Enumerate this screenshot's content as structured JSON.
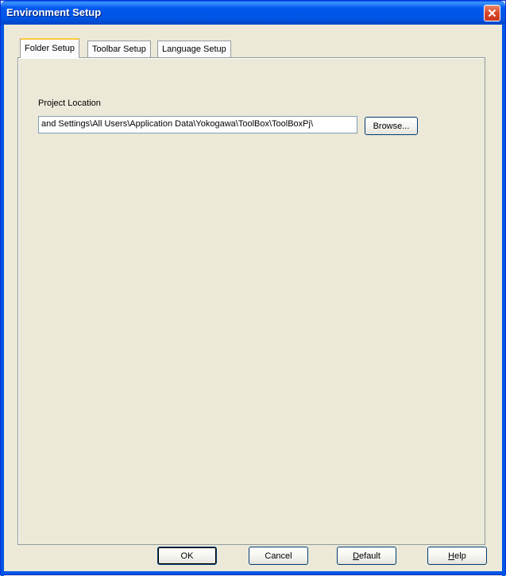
{
  "window": {
    "title": "Environment Setup"
  },
  "tabs": [
    {
      "label": "Folder Setup",
      "active": true
    },
    {
      "label": "Toolbar Setup",
      "active": false
    },
    {
      "label": "Language Setup",
      "active": false
    }
  ],
  "folder_setup": {
    "project_location_label": "Project Location",
    "project_location_value": " and Settings\\All Users\\Application Data\\Yokogawa\\ToolBox\\ToolBoxPj\\",
    "browse_label": "Browse..."
  },
  "footer": {
    "ok_label": "OK",
    "cancel_label": "Cancel",
    "default_label": "Default",
    "default_mnemonic": "D",
    "default_rest": "efault",
    "help_label": "Help",
    "help_mnemonic": "H",
    "help_rest": "elp"
  },
  "colors": {
    "titlebar": "#0055E5",
    "dialog_bg": "#ECE9D8",
    "close_button": "#D9472B",
    "active_tab_accent": "#FFC83C"
  }
}
